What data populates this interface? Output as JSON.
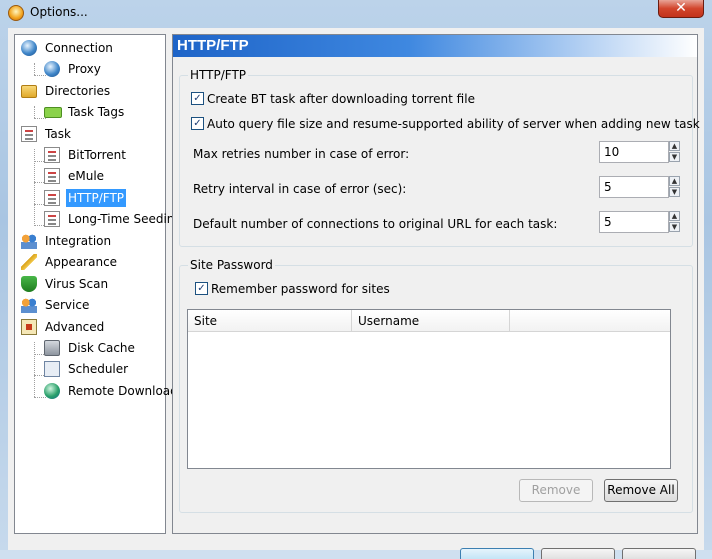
{
  "window": {
    "title": "Options...",
    "close_glyph": "✕"
  },
  "nav": {
    "items": [
      {
        "label": "Connection",
        "icon": "globe-network-icon"
      },
      {
        "label": "Proxy",
        "icon": "proxy-globe-icon"
      },
      {
        "label": "Directories",
        "icon": "folder-icon"
      },
      {
        "label": "Task Tags",
        "icon": "tag-icon"
      },
      {
        "label": "Task",
        "icon": "task-sheet-icon"
      },
      {
        "label": "BitTorrent",
        "icon": "task-sheet-icon"
      },
      {
        "label": "eMule",
        "icon": "task-sheet-icon"
      },
      {
        "label": "HTTP/FTP",
        "icon": "task-sheet-icon",
        "selected": true
      },
      {
        "label": "Long-Time Seeding",
        "icon": "task-sheet-icon"
      },
      {
        "label": "Integration",
        "icon": "people-icon"
      },
      {
        "label": "Appearance",
        "icon": "brush-icon"
      },
      {
        "label": "Virus Scan",
        "icon": "shield-icon"
      },
      {
        "label": "Service",
        "icon": "people-icon"
      },
      {
        "label": "Advanced",
        "icon": "control-panel-icon"
      },
      {
        "label": "Disk Cache",
        "icon": "disk-icon"
      },
      {
        "label": "Scheduler",
        "icon": "scheduler-icon"
      },
      {
        "label": "Remote Download",
        "icon": "earth-icon"
      }
    ]
  },
  "content": {
    "header": "HTTP/FTP",
    "group1": {
      "title": "HTTP/FTP",
      "create_bt_task": {
        "label": "Create BT task after downloading torrent file",
        "checked": true
      },
      "auto_query": {
        "label": "Auto query file size and resume-supported ability of server when adding new task",
        "checked": true
      },
      "max_retries": {
        "label": "Max retries number in case of error:",
        "value": "10"
      },
      "retry_interval": {
        "label": "Retry interval in case of error (sec):",
        "value": "5"
      },
      "connections": {
        "label": "Default number of connections to original URL for each task:",
        "value": "5"
      }
    },
    "group2": {
      "title": "Site Password",
      "remember": {
        "label": "Remember password for sites",
        "checked": true
      },
      "columns": [
        "Site",
        "Username",
        ""
      ],
      "remove_label": "Remove",
      "remove_all_label": "Remove All"
    }
  },
  "check_glyph": "✓"
}
